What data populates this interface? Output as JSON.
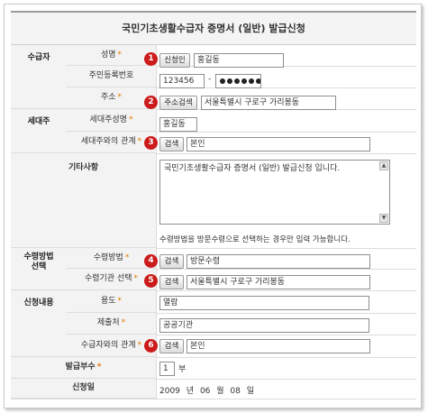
{
  "title": "국민기초생활수급자 증명서 (일반) 발급신청",
  "required_mark": "*",
  "groups": {
    "recipient": "수급자",
    "household": "세대주",
    "receive_method_line1": "수령방법",
    "receive_method_line2": "선택",
    "application": "신청내용"
  },
  "labels": {
    "name": "성명",
    "rrn": "주민등록번호",
    "address": "주소",
    "household_name": "세대주성명",
    "household_relation": "세대주와의 관계",
    "other": "기타사항",
    "method": "수령방법",
    "agency": "수령기관 선택",
    "purpose": "용도",
    "submit_to": "제출처",
    "recipient_relation": "수급자와의 관계",
    "copies": "발급부수",
    "apply_date": "신청일"
  },
  "buttons": {
    "verify": "신청인",
    "address_search": "주소검색",
    "search": "검색"
  },
  "badges": [
    "1",
    "2",
    "3",
    "4",
    "5",
    "6"
  ],
  "values": {
    "name": "홍길동",
    "rrn_front": "123456",
    "rrn_sep": "-",
    "address": "서울특별시 구로구 가리봉동",
    "household_name": "홍길동",
    "household_relation": "본인",
    "other_text": "국민기초생활수급자 증명서 (일반) 발급신청 입니다.",
    "other_note": "수령방법을 방문수령으로 선택하는 경우만 입력 가능합니다.",
    "method": "방문수령",
    "agency": "서울특별시 구로구 가리봉동",
    "purpose": "열람",
    "submit_to": "공공기관",
    "recipient_relation": "본인",
    "copies": "1",
    "copies_unit": "부",
    "date_year": "2009",
    "date_year_unit": "년",
    "date_month": "06",
    "date_month_unit": "월",
    "date_day": "08",
    "date_day_unit": "일"
  },
  "colors": {
    "badge": "#cc1b1b",
    "required": "#e07b00",
    "label_bg": "#f3f3f3"
  }
}
